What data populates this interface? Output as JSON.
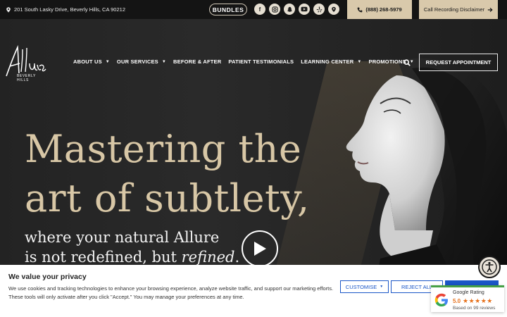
{
  "topbar": {
    "address": "201 South Lasky Drive, Beverly Hills, CA 90212",
    "bundles": "BUNDLES",
    "social_icons": [
      "facebook-icon",
      "instagram-icon",
      "snapchat-icon",
      "youtube-icon",
      "yelp-icon",
      "location-icon"
    ],
    "phone": "(888) 268-5979",
    "call_disclaimer": "Call Recording Disclaimer"
  },
  "logo": {
    "script": "Allure",
    "sub": "BEVERLY HILLS"
  },
  "nav": {
    "items": [
      {
        "label": "ABOUT US",
        "dropdown": true
      },
      {
        "label": "OUR SERVICES",
        "dropdown": true
      },
      {
        "label": "BEFORE & AFTER",
        "dropdown": false
      },
      {
        "label": "PATIENT TESTIMONIALS",
        "dropdown": false
      },
      {
        "label": "LEARNING CENTER",
        "dropdown": true
      },
      {
        "label": "PROMOTIONS",
        "dropdown": true
      }
    ],
    "request": "REQUEST APPOINTMENT"
  },
  "hero": {
    "headline_line1": "Mastering the",
    "headline_line2": "art of subtlety,",
    "sub_line1": "where your natural Allure",
    "sub_line2_a": "is not redefined, but ",
    "sub_line2_b": "refined",
    "sub_line2_c": "."
  },
  "cookie": {
    "title": "We value your privacy",
    "text": "We use cookies and tracking technologies to enhance your browsing experience, analyze website traffic, and support our marketing efforts. These tools will only activate after you click \"Accept.\" You may manage your preferences at any time.",
    "customise": "CUSTOMISE",
    "reject": "REJECT ALL",
    "accept": ""
  },
  "google": {
    "title": "Google Rating",
    "score": "5.0",
    "stars": "★★★★★",
    "based": "Based on 99 reviews"
  },
  "colors": {
    "gold": "#d9c9ab",
    "headline": "#d8c7a6",
    "cookie_blue": "#1a56c7",
    "google_star": "#e7711b"
  }
}
